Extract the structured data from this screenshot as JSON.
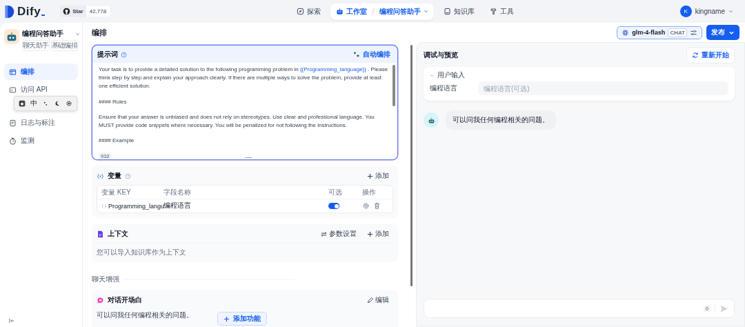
{
  "brand": {
    "name": "Dify",
    "github_label": "Star",
    "stars_count": "42,778"
  },
  "nav": [
    {
      "label": "探索",
      "selected": false
    },
    {
      "label": "工作室",
      "selected": true,
      "crumb": "编程问答助手"
    },
    {
      "label": "知识库",
      "selected": false
    },
    {
      "label": "工具",
      "selected": false
    }
  ],
  "user": {
    "initial": "K",
    "name": "kingname"
  },
  "app": {
    "name": "编程问答助手",
    "tags": [
      "聊天助手",
      "基础编排"
    ]
  },
  "sidebar": {
    "items": [
      {
        "label": "编排",
        "selected": true
      },
      {
        "label": "访问 API",
        "selected": false
      },
      {
        "label": "日志与标注",
        "selected": false
      },
      {
        "label": "监测",
        "selected": false
      }
    ]
  },
  "ime_toolbar": {
    "label": "中"
  },
  "editor": {
    "title": "编排",
    "model": "glm-4-flash",
    "model_badge": "CHAT",
    "publish": "发布"
  },
  "prompt": {
    "title": "提示词",
    "auto_label": "自动编排",
    "char_count": "910",
    "paragraphs": [
      {
        "parts": [
          {
            "kind": "plain",
            "text": "Your task is to provide a detailed solution to the following programming problem in "
          },
          {
            "kind": "variable",
            "text": "{{Programming_language}}"
          },
          {
            "kind": "plain",
            "text": " . Please think step by step and explain your approach clearly. If there are multiple ways to solve the problem, provide at least one efficient solution."
          }
        ]
      },
      {
        "parts": [
          {
            "kind": "plain",
            "text": "#### Rules"
          }
        ]
      },
      {
        "parts": [
          {
            "kind": "plain",
            "text": "Ensure that your answer is unbiased and does not rely on stereotypes. Use clear and professional language. You MUST provide code snippets where necessary. You will be penalized for not following the instructions."
          }
        ]
      },
      {
        "parts": [
          {
            "kind": "plain",
            "text": "#### Example"
          }
        ]
      }
    ]
  },
  "variables": {
    "title": "变量",
    "add": "添加",
    "columns": [
      "变量 KEY",
      "字段名称",
      "可选",
      "操作"
    ],
    "rows": [
      {
        "key": "Programming_langu",
        "name": "编程语言",
        "optional": true
      }
    ]
  },
  "context": {
    "title": "上下文",
    "settings": "参数设置",
    "add": "添加",
    "hint": "您可以导入知识库作为上下文"
  },
  "section_label": "聊天增强",
  "opener": {
    "title": "对话开场白",
    "edit": "编辑",
    "text": "可以问我任何编程相关的问题。"
  },
  "add_feature": "添加功能",
  "preview": {
    "title": "调试与预览",
    "restart": "重新开始",
    "user_input": {
      "label": "用户输入",
      "expanded": true,
      "fields": [
        {
          "label": "编程语言",
          "placeholder": "编程语言(可选)"
        }
      ]
    },
    "messages": [
      {
        "text": "可以问我任何编程相关的问题。"
      }
    ],
    "composer": {
      "count": "0"
    }
  }
}
